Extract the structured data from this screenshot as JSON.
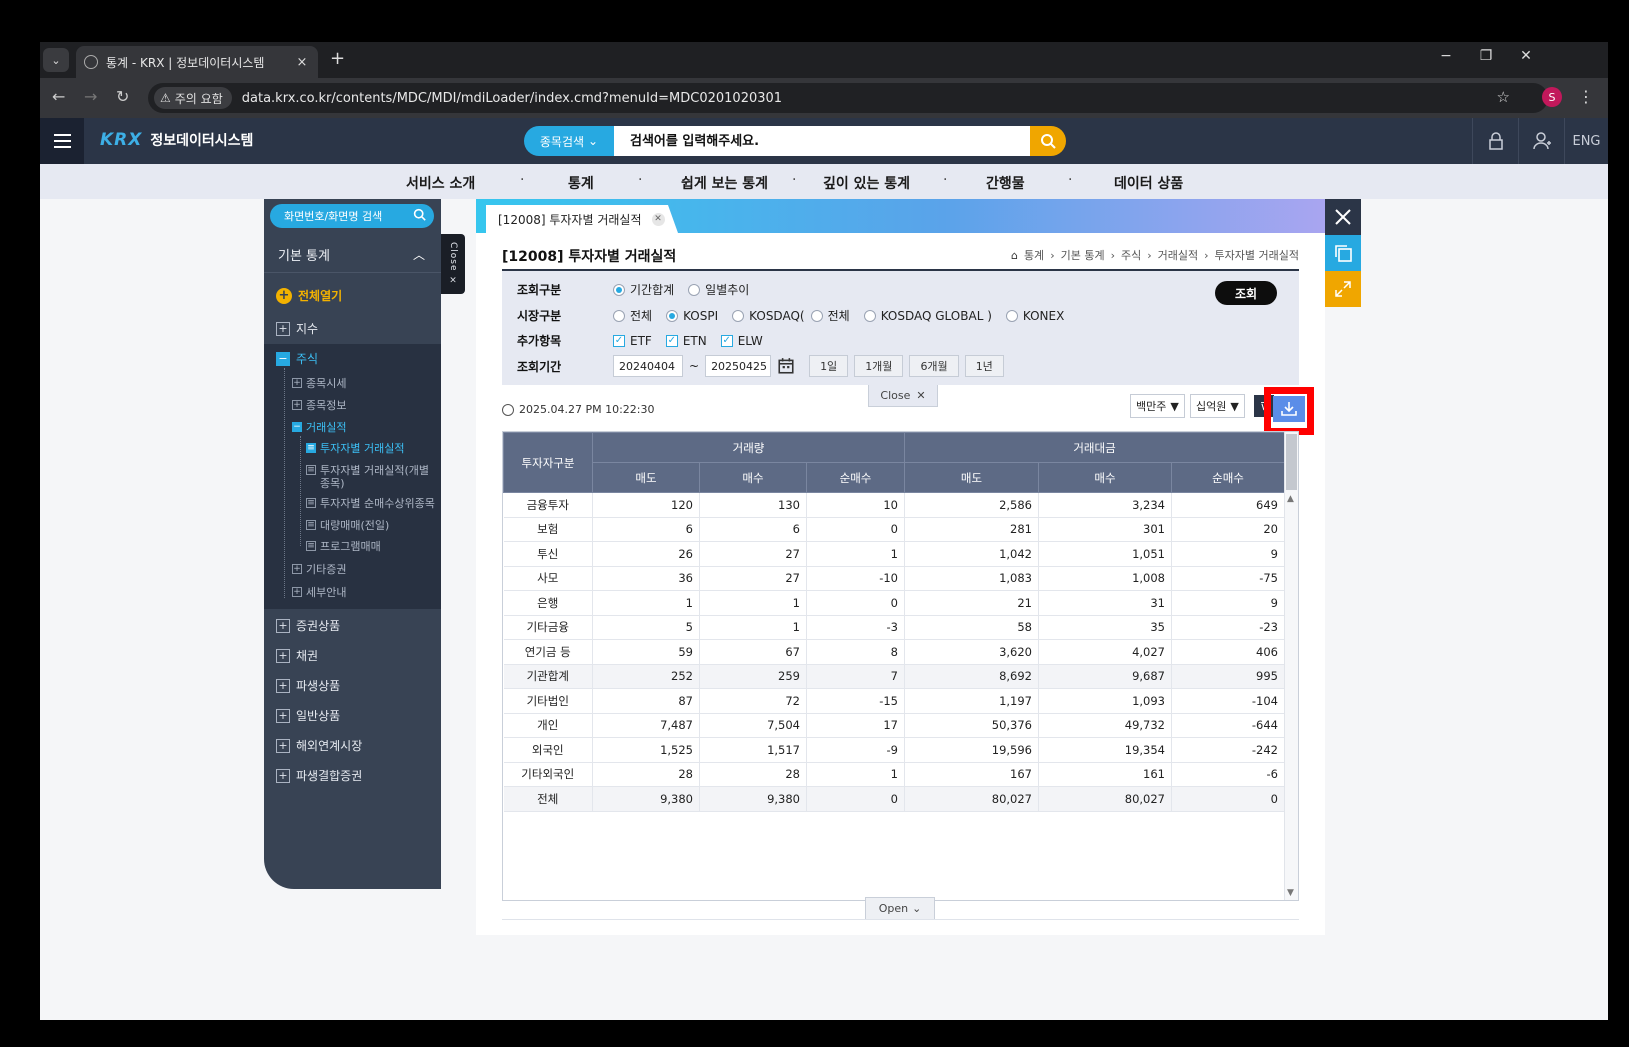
{
  "browser": {
    "tab_title": "통계 - KRX | 정보데이터시스템",
    "tab_close": "×",
    "new_tab": "+",
    "win_min": "−",
    "win_max": "❐",
    "win_close": "✕",
    "security_warning": "주의 요함",
    "url": "data.krx.co.kr/contents/MDC/MDI/mdiLoader/index.cmd?menuId=MDC0201020301",
    "profile_initial": "S"
  },
  "site": {
    "logo_brand": "KRX",
    "logo_text": "정보데이터시스템",
    "search_category": "종목검색",
    "search_placeholder": "검색어를 입력해주세요.",
    "lang": "ENG"
  },
  "mainnav": [
    "서비스 소개",
    "통계",
    "쉽게 보는 통계",
    "깊이 있는 통계",
    "간행물",
    "데이터 상품"
  ],
  "sidebar": {
    "search_label": "화면번호/화면명 검색",
    "section_title": "기본 통계",
    "expand_all": "전체열기",
    "items": [
      "지수",
      "주식",
      "증권상품",
      "채권",
      "파생상품",
      "일반상품",
      "해외연계시장",
      "파생결합증권"
    ],
    "stock_sub": [
      "종목시세",
      "종목정보",
      "거래실적",
      "기타증권",
      "세부안내"
    ],
    "trade_sub": [
      "투자자별 거래실적",
      "투자자별 거래실적(개별종목)",
      "투자자별 순매수상위종목",
      "대량매매(전일)",
      "프로그램매매"
    ],
    "close_label": "Close ×"
  },
  "content": {
    "tab_label": "[12008] 투자자별 거래실적",
    "page_title": "[12008] 투자자별 거래실적",
    "breadcrumb": [
      "통계",
      "기본 통계",
      "주식",
      "거래실적",
      "투자자별 거래실적"
    ],
    "filter": {
      "row1_label": "조회구분",
      "row1_options": [
        "기간합계",
        "일별추이"
      ],
      "row2_label": "시장구분",
      "row2_options": [
        "전체",
        "KOSPI",
        "KOSDAQ(",
        "전체",
        "KOSDAQ GLOBAL )",
        "KONEX"
      ],
      "row3_label": "추가항목",
      "row3_options": [
        "ETF",
        "ETN",
        "ELW"
      ],
      "row4_label": "조회기간",
      "date_from": "20240404",
      "date_sep": "~",
      "date_to": "20250425",
      "period_buttons": [
        "1일",
        "1개월",
        "6개월",
        "1년"
      ],
      "query_button": "조회"
    },
    "close_label": "Close",
    "timestamp": "2025.04.27 PM 10:22:30",
    "unit_volume": "백만주",
    "unit_value": "십억원",
    "open_label": "Open"
  },
  "table": {
    "col_investor": "투자자구분",
    "group_volume": "거래량",
    "group_value": "거래대금",
    "sub_headers": [
      "매도",
      "매수",
      "순매수",
      "매도",
      "매수",
      "순매수"
    ],
    "rows": [
      [
        "금융투자",
        "120",
        "130",
        "10",
        "2,586",
        "3,234",
        "649"
      ],
      [
        "보험",
        "6",
        "6",
        "0",
        "281",
        "301",
        "20"
      ],
      [
        "투신",
        "26",
        "27",
        "1",
        "1,042",
        "1,051",
        "9"
      ],
      [
        "사모",
        "36",
        "27",
        "-10",
        "1,083",
        "1,008",
        "-75"
      ],
      [
        "은행",
        "1",
        "1",
        "0",
        "21",
        "31",
        "9"
      ],
      [
        "기타금융",
        "5",
        "1",
        "-3",
        "58",
        "35",
        "-23"
      ],
      [
        "연기금 등",
        "59",
        "67",
        "8",
        "3,620",
        "4,027",
        "406"
      ],
      [
        "기관합계",
        "252",
        "259",
        "7",
        "8,692",
        "9,687",
        "995"
      ],
      [
        "기타법인",
        "87",
        "72",
        "-15",
        "1,197",
        "1,093",
        "-104"
      ],
      [
        "개인",
        "7,487",
        "7,504",
        "17",
        "50,376",
        "49,732",
        "-644"
      ],
      [
        "외국인",
        "1,525",
        "1,517",
        "-9",
        "19,596",
        "19,354",
        "-242"
      ],
      [
        "기타외국인",
        "28",
        "28",
        "1",
        "167",
        "161",
        "-6"
      ],
      [
        "전체",
        "9,380",
        "9,380",
        "0",
        "80,027",
        "80,027",
        "0"
      ]
    ]
  },
  "colors": {
    "header_bg": "#2b3547",
    "accent": "#27a9e1",
    "search_btn": "#f0a600",
    "highlight": "#ff0000"
  }
}
